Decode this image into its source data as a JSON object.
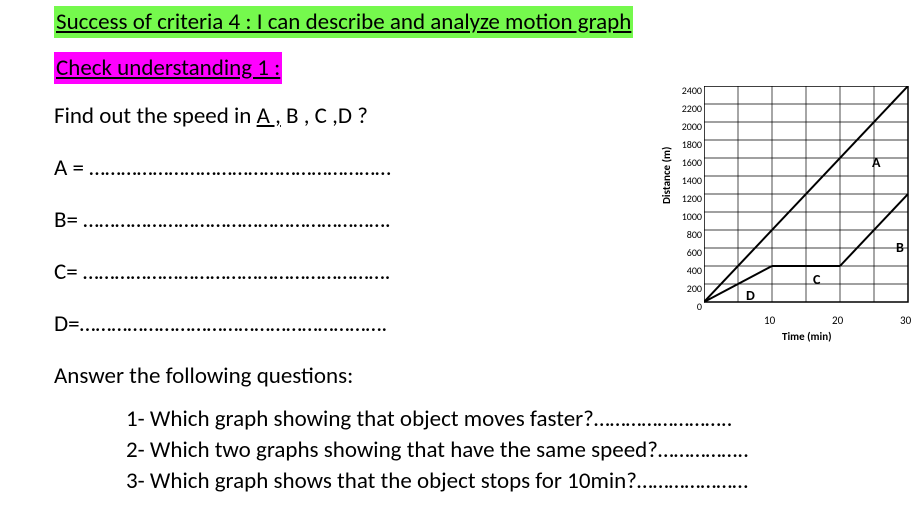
{
  "title_line": "Success of criteria 4 : I can describe and analyze motion graph",
  "check_line": "Check understanding  1  :",
  "prompt_pre": "Find out the speed in ",
  "prompt_A": "A ,",
  "prompt_rest": " B , C ,D ?",
  "blanks": {
    "A": "A = …………………………………………………",
    "B": "B= ………………………………………………….",
    "C": "C= ………………………………………………….",
    "D": "D=…………………………………………………."
  },
  "followup": "Answer the following questions:",
  "questions": {
    "q1": "1-  Which graph showing that object moves faster?……………………..",
    "q2": "2-  Which two graphs showing that have the same speed?……………..",
    "q3": "3-  Which graph shows that the object stops for 10min?…………………"
  },
  "chart_data": {
    "type": "line",
    "title": "",
    "xlabel": "Time (min)",
    "ylabel": "Distance (m)",
    "xlim": [
      0,
      30
    ],
    "ylim": [
      0,
      2400
    ],
    "x_ticks": [
      10,
      20,
      30
    ],
    "y_ticks": [
      0,
      200,
      400,
      600,
      800,
      1000,
      1200,
      1400,
      1600,
      1800,
      2000,
      2200,
      2400
    ],
    "series": [
      {
        "name": "A",
        "points": [
          [
            0,
            0
          ],
          [
            30,
            2400
          ]
        ]
      },
      {
        "name": "B",
        "points": [
          [
            20,
            400
          ],
          [
            30,
            1200
          ]
        ]
      },
      {
        "name": "C",
        "points": [
          [
            10,
            400
          ],
          [
            20,
            400
          ]
        ]
      },
      {
        "name": "D",
        "points": [
          [
            0,
            0
          ],
          [
            10,
            400
          ]
        ]
      }
    ]
  },
  "series_labels": {
    "A": "A",
    "B": "B",
    "C": "C",
    "D": "D"
  }
}
